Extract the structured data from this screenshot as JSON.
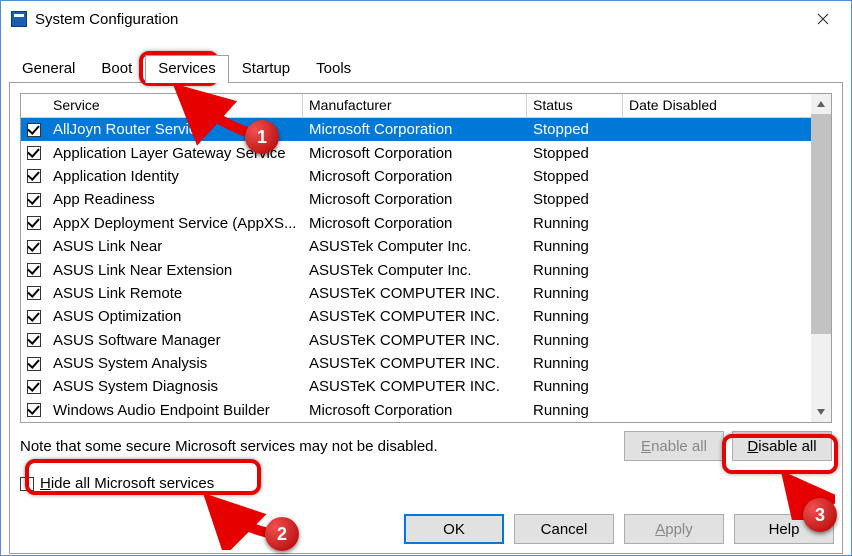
{
  "window": {
    "title": "System Configuration"
  },
  "tabs": [
    "General",
    "Boot",
    "Services",
    "Startup",
    "Tools"
  ],
  "active_tab_index": 2,
  "columns": {
    "service": "Service",
    "manufacturer": "Manufacturer",
    "status": "Status",
    "date_disabled": "Date Disabled"
  },
  "services": [
    {
      "checked": true,
      "name": "AllJoyn Router Service",
      "manufacturer": "Microsoft Corporation",
      "status": "Stopped",
      "date_disabled": "",
      "selected": true
    },
    {
      "checked": true,
      "name": "Application Layer Gateway Service",
      "manufacturer": "Microsoft Corporation",
      "status": "Stopped",
      "date_disabled": ""
    },
    {
      "checked": true,
      "name": "Application Identity",
      "manufacturer": "Microsoft Corporation",
      "status": "Stopped",
      "date_disabled": ""
    },
    {
      "checked": true,
      "name": "App Readiness",
      "manufacturer": "Microsoft Corporation",
      "status": "Stopped",
      "date_disabled": ""
    },
    {
      "checked": true,
      "name": "AppX Deployment Service (AppXS...",
      "manufacturer": "Microsoft Corporation",
      "status": "Running",
      "date_disabled": ""
    },
    {
      "checked": true,
      "name": "ASUS Link Near",
      "manufacturer": "ASUSTek Computer Inc.",
      "status": "Running",
      "date_disabled": ""
    },
    {
      "checked": true,
      "name": "ASUS Link Near Extension",
      "manufacturer": "ASUSTek Computer Inc.",
      "status": "Running",
      "date_disabled": ""
    },
    {
      "checked": true,
      "name": "ASUS Link Remote",
      "manufacturer": "ASUSTeK COMPUTER INC.",
      "status": "Running",
      "date_disabled": ""
    },
    {
      "checked": true,
      "name": "ASUS Optimization",
      "manufacturer": "ASUSTeK COMPUTER INC.",
      "status": "Running",
      "date_disabled": ""
    },
    {
      "checked": true,
      "name": "ASUS Software Manager",
      "manufacturer": "ASUSTeK COMPUTER INC.",
      "status": "Running",
      "date_disabled": ""
    },
    {
      "checked": true,
      "name": "ASUS System Analysis",
      "manufacturer": "ASUSTeK COMPUTER INC.",
      "status": "Running",
      "date_disabled": ""
    },
    {
      "checked": true,
      "name": "ASUS System Diagnosis",
      "manufacturer": "ASUSTeK COMPUTER INC.",
      "status": "Running",
      "date_disabled": ""
    },
    {
      "checked": true,
      "name": "Windows Audio Endpoint Builder",
      "manufacturer": "Microsoft Corporation",
      "status": "Running",
      "date_disabled": ""
    }
  ],
  "note": "Note that some secure Microsoft services may not be disabled.",
  "buttons": {
    "enable_all": "Enable all",
    "disable_all": "Disable all",
    "ok": "OK",
    "cancel": "Cancel",
    "apply": "Apply",
    "help": "Help"
  },
  "hide_checkbox": {
    "label_pre": "H",
    "label_rest": "ide all Microsoft services",
    "checked": false
  },
  "annotations": {
    "badge1": "1",
    "badge2": "2",
    "badge3": "3"
  }
}
